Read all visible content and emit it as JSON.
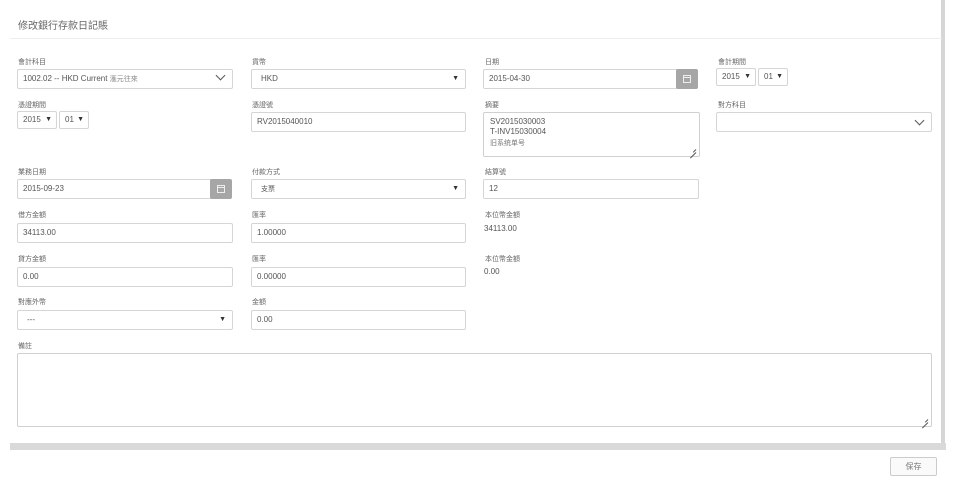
{
  "page": {
    "title": "修改銀行存款日記賬"
  },
  "form": {
    "account_code": {
      "label": "會計科目",
      "value": "1002.02 -- HKD Current",
      "value_suffix": "滙元往來"
    },
    "currency": {
      "label": "貨幣",
      "value": "HKD"
    },
    "date": {
      "label": "日期",
      "value": "2015-04-30"
    },
    "accounting_period": {
      "label": "會計期間",
      "year": "2015",
      "month": "01"
    },
    "voucher_period": {
      "label": "憑證期間",
      "year": "2015",
      "month": "01"
    },
    "voucher_no": {
      "label": "憑證號",
      "value": "RV2015040010"
    },
    "summary": {
      "label": "摘要",
      "lines": [
        "SV2015030003",
        "T-INV15030004",
        "旧系统单号"
      ]
    },
    "contra_account": {
      "label": "對方科目",
      "value": ""
    },
    "business_date": {
      "label": "業務日期",
      "value": "2015-09-23"
    },
    "payment_method": {
      "label": "付款方式",
      "value": "支票"
    },
    "settlement_no": {
      "label": "結算號",
      "value": "12"
    },
    "debit_amount": {
      "label": "借方金額",
      "value": "34113.00"
    },
    "debit_rate": {
      "label": "匯率",
      "value": "1.00000"
    },
    "debit_base_amount": {
      "label": "本位幣金額",
      "value": "34113.00"
    },
    "credit_amount": {
      "label": "貸方金額",
      "value": "0.00"
    },
    "credit_rate": {
      "label": "匯率",
      "value": "0.00000"
    },
    "credit_base_amount": {
      "label": "本位幣金額",
      "value": "0.00"
    },
    "foreign_currency": {
      "label": "對應外幣",
      "value": "---"
    },
    "amount": {
      "label": "金額",
      "value": "0.00"
    },
    "remarks": {
      "label": "備註",
      "value": ""
    }
  },
  "footer": {
    "save_label": "保存"
  },
  "icons": {
    "dropdown_caret": "▼",
    "calendar": "calendar-icon",
    "chevron": "chevron-down-icon"
  },
  "colors": {
    "calendar_button": "#a6a6a6",
    "border": "#d5d5d5",
    "text": "#555555"
  }
}
